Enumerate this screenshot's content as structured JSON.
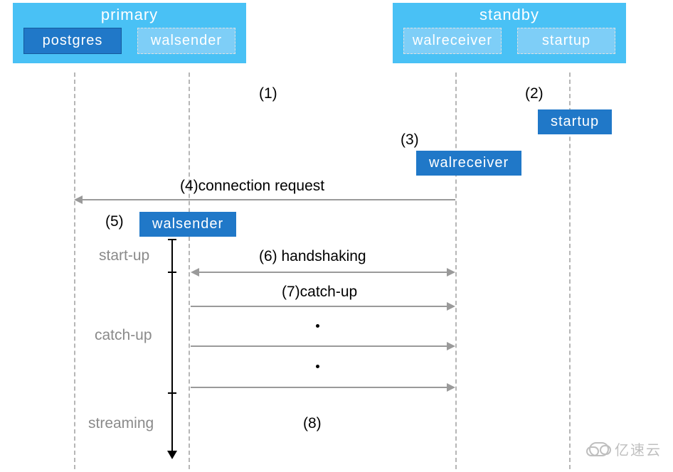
{
  "chart_data": {
    "type": "sequence",
    "actors": [
      {
        "host": "primary",
        "processes": [
          "postgres",
          "walsender"
        ]
      },
      {
        "host": "standby",
        "processes": [
          "walreceiver",
          "startup"
        ]
      }
    ],
    "steps": [
      {
        "n": 1,
        "text": "(1)"
      },
      {
        "n": 2,
        "text": "(2)",
        "spawn": "startup"
      },
      {
        "n": 3,
        "text": "(3)",
        "spawn": "walreceiver"
      },
      {
        "n": 4,
        "text": "(4)connection request",
        "from": "walreceiver",
        "to": "postgres"
      },
      {
        "n": 5,
        "text": "(5)",
        "spawn": "walsender"
      },
      {
        "n": 6,
        "text": "(6) handshaking",
        "between": [
          "walsender",
          "walreceiver"
        ],
        "dir": "both"
      },
      {
        "n": 7,
        "text": "(7)catch-up",
        "between": [
          "walsender",
          "walreceiver"
        ],
        "dir": "right"
      },
      {
        "n": 8,
        "text": "(8)"
      }
    ],
    "phases": [
      "start-up",
      "catch-up",
      "streaming"
    ]
  },
  "primary": {
    "title": "primary",
    "proc_active": "postgres",
    "proc_inactive": "walsender"
  },
  "standby": {
    "title": "standby",
    "proc_inactive1": "walreceiver",
    "proc_inactive2": "startup"
  },
  "step1": "(1)",
  "step2": "(2)",
  "step3": "(3)",
  "step4": "(4)connection request",
  "step5": "(5)",
  "step6": "(6) handshaking",
  "step7": "(7)catch-up",
  "step8": "(8)",
  "spawn_startup": "startup",
  "spawn_walreceiver": "walreceiver",
  "spawn_walsender": "walsender",
  "phase1": "start-up",
  "phase2": "catch-up",
  "phase3": "streaming",
  "watermark": "亿速云"
}
